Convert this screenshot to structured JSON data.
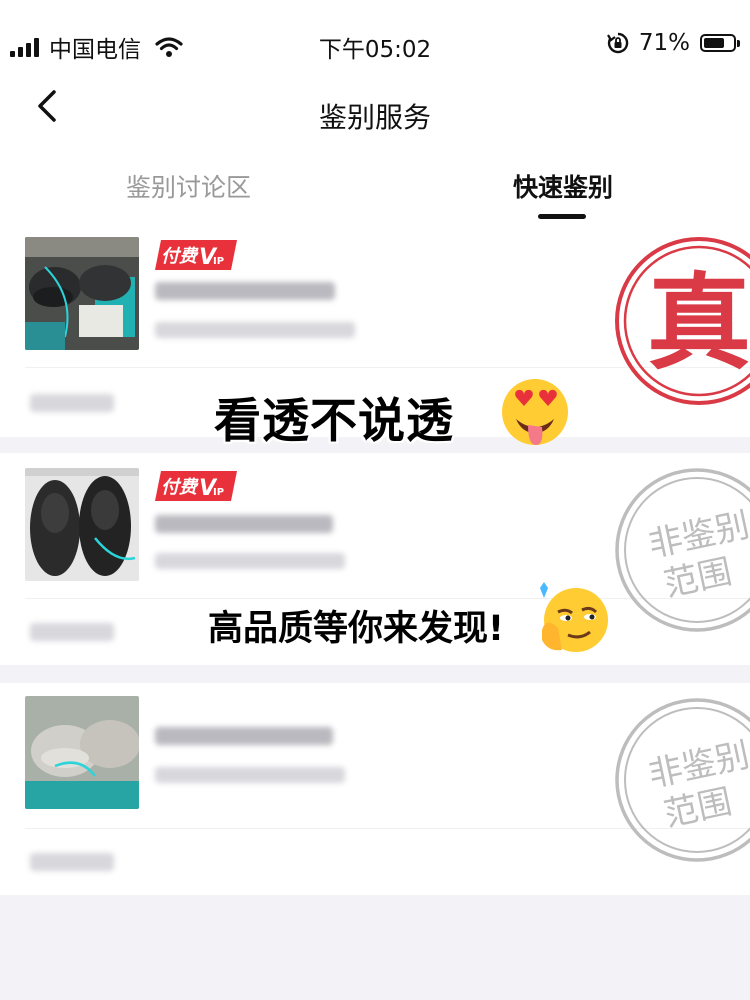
{
  "status_bar": {
    "carrier": "中国电信",
    "time": "下午05:02",
    "battery": "71%",
    "battery_level": 0.71,
    "icons": [
      "signal-icon",
      "wifi-icon",
      "orientation-lock-icon",
      "battery-icon"
    ]
  },
  "nav": {
    "back_icon": "chevron-left-icon",
    "title": "鉴别服务"
  },
  "tabs": [
    {
      "label": "鉴别讨论区",
      "active": false
    },
    {
      "label": "快速鉴别",
      "active": true
    }
  ],
  "badge": {
    "text": "付费",
    "suffix_v": "V",
    "suffix_ip": "IP",
    "color": "#e8313a"
  },
  "stamps": {
    "authentic": "真",
    "not_in_scope_line1": "非鉴别",
    "not_in_scope_line2": "范围",
    "red": "#d93a45",
    "gray": "#bdbdbd"
  },
  "cards": [
    {
      "vip": true,
      "stamp": "authentic",
      "image": "black-sneakers-with-box"
    },
    {
      "vip": true,
      "stamp": "not_in_scope",
      "image": "black-sneakers"
    },
    {
      "vip": false,
      "stamp": "not_in_scope",
      "image": "grey-sneakers"
    }
  ],
  "overlays": {
    "line1": "看透不说透",
    "line2": "高品质等你来发现!",
    "emoji1": "heart-eyes-tongue-emoji",
    "emoji2": "smirk-emoji"
  }
}
